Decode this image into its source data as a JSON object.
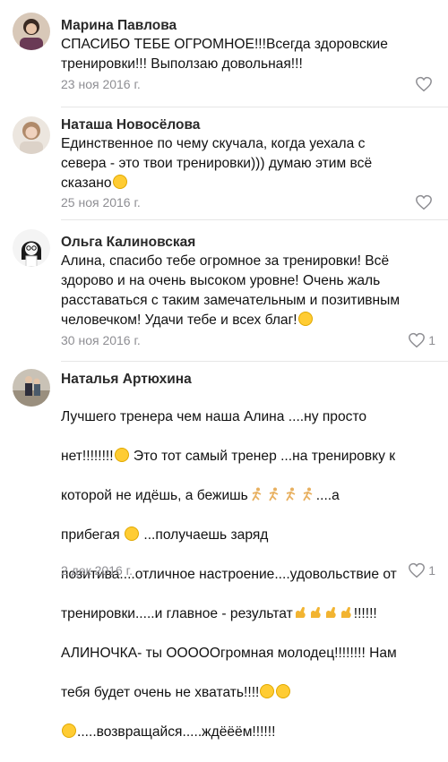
{
  "comments": [
    {
      "author": "Марина Павлова",
      "text": "СПАСИБО ТЕБЕ ОГРОМНОЕ!!!Всегда здоровские\nтренировки!!! Выползаю довольная!!!",
      "date": "23 ноя 2016 г.",
      "likes": ""
    },
    {
      "author": "Наташа Новосёлова",
      "text_a": "Единственное по чему скучала, когда уехала с\nсевера - это твои тренировки))) думаю этим всё\nсказано",
      "date": "25 ноя 2016 г.",
      "likes": ""
    },
    {
      "author": "Ольга Калиновская",
      "text_a": "Алина, спасибо тебе огромное за тренировки! Всё\nздорово и на очень высоком уровне! Очень жаль\nрасставаться с таким замечательным и позитивным\nчеловечком! Удачи тебе и всех благ!",
      "date": "30 ноя 2016 г.",
      "likes": "1"
    },
    {
      "author": "Наталья Артюхина",
      "line1": "Лучшего тренера чем наша Алина ....ну просто",
      "line2a": "нет!!!!!!!!",
      "line2b": " Это тот самый тренер ...на тренировку к",
      "line3a": "которой не идёшь, а бежишь",
      "line3b": "....а",
      "line4a": "прибегая ",
      "line4b": " ...получаешь заряд",
      "line5": "позитива....отличное настроение....удовольствие от",
      "line6a": "тренировки.....и главное - результат",
      "line6b": "!!!!!!",
      "line7": "АЛИНОЧКА- ты ОООООгромная молодец!!!!!!!! Нам",
      "line8a": "тебя будет очень не хватать!!!!",
      "line9a": ".....возвращайся.....ждёёём!!!!!!",
      "date": "2 дек 2016 г.",
      "likes": "1"
    }
  ]
}
